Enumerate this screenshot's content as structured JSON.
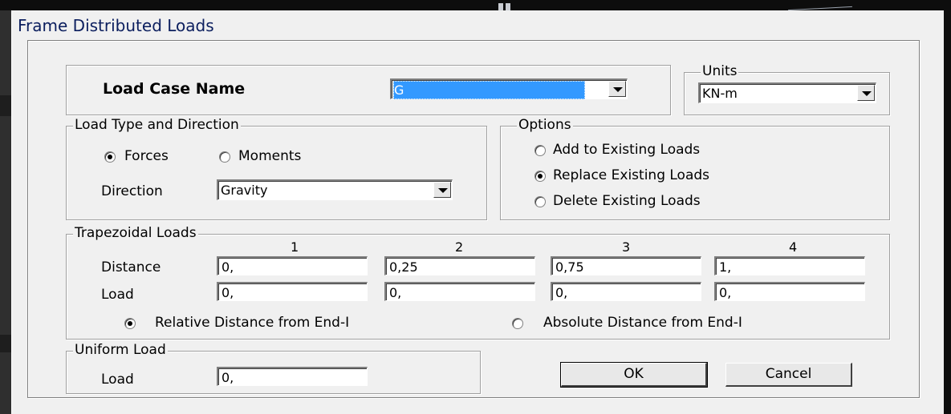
{
  "dialog": {
    "title": "Frame Distributed Loads"
  },
  "load_case": {
    "label": "Load Case Name",
    "value": "G"
  },
  "units": {
    "legend": "Units",
    "value": "KN-m"
  },
  "load_type": {
    "legend": "Load Type and Direction",
    "forces_label": "Forces",
    "moments_label": "Moments",
    "selected": "Forces",
    "direction_label": "Direction",
    "direction_value": "Gravity"
  },
  "options": {
    "legend": "Options",
    "items": [
      {
        "label": "Add to Existing Loads",
        "selected": false
      },
      {
        "label": "Replace Existing Loads",
        "selected": true
      },
      {
        "label": "Delete Existing Loads",
        "selected": false
      }
    ]
  },
  "trapezoidal": {
    "legend": "Trapezoidal Loads",
    "columns": [
      "1",
      "2",
      "3",
      "4"
    ],
    "distance_label": "Distance",
    "load_label": "Load",
    "distances": [
      "0,",
      "0,25",
      "0,75",
      "1,"
    ],
    "loads": [
      "0,",
      "0,",
      "0,",
      "0,"
    ],
    "relative_label": "Relative Distance from End-I",
    "absolute_label": "Absolute Distance from End-I",
    "selected": "relative"
  },
  "uniform": {
    "legend": "Uniform Load",
    "load_label": "Load",
    "load_value": "0,"
  },
  "buttons": {
    "ok": "OK",
    "cancel": "Cancel"
  }
}
